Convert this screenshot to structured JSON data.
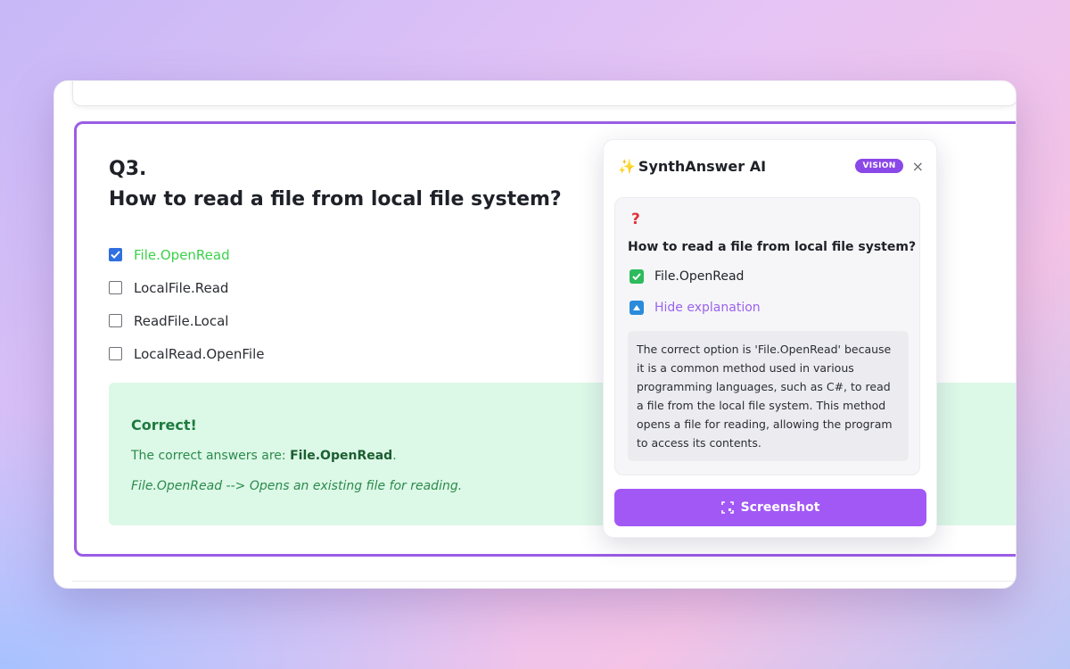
{
  "quiz": {
    "question_number": "Q3.",
    "question_title": "How to read a file from local file system?",
    "options": [
      {
        "label": "File.OpenRead",
        "checked": true,
        "correct": true
      },
      {
        "label": "LocalFile.Read",
        "checked": false,
        "correct": false
      },
      {
        "label": "ReadFile.Local",
        "checked": false,
        "correct": false
      },
      {
        "label": "LocalRead.OpenFile",
        "checked": false,
        "correct": false
      }
    ],
    "feedback": {
      "title": "Correct!",
      "answer_prefix": "The correct answers are: ",
      "answer_value": "File.OpenRead",
      "answer_suffix": ".",
      "explanation": "File.OpenRead --> Opens an existing file for reading."
    }
  },
  "panel": {
    "sparkle": "✨",
    "title": "SynthAnswer AI",
    "badge": "VISION",
    "close": "×",
    "question_mark": "?",
    "question": "How to read a file from local file system?",
    "answer": "File.OpenRead",
    "hide_explanation": "Hide explanation",
    "explanation": "The correct option is 'File.OpenRead' because it is a common method used in various programming languages, such as C#, to read a file from the local file system. This method opens a file for reading, allowing the program to access its contents.",
    "screenshot_label": "Screenshot"
  },
  "colors": {
    "accent_purple": "#9b5de5",
    "button_purple": "#a258f5",
    "correct_green": "#3ad14a",
    "feedback_bg": "#dcf8e7"
  }
}
